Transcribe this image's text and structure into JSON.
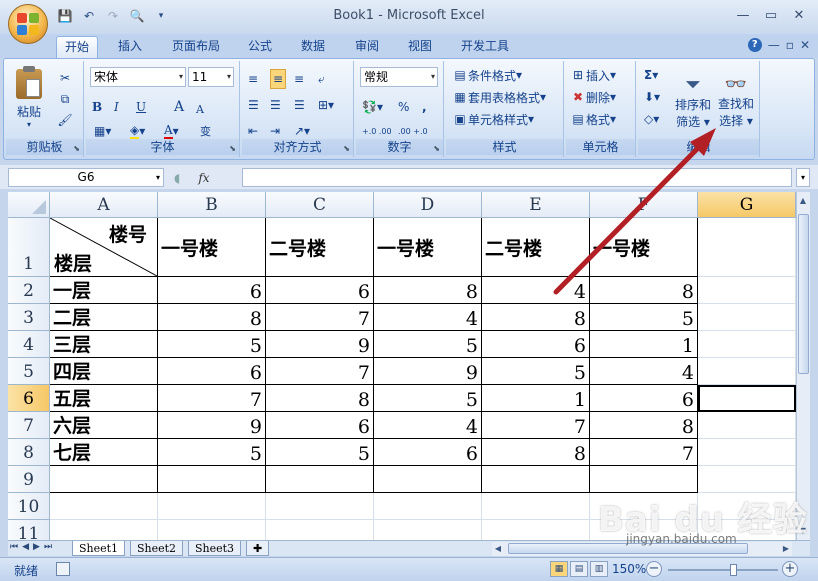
{
  "window": {
    "title": "Book1 - Microsoft Excel"
  },
  "qat": {
    "save": "💾",
    "undo": "↶",
    "redo": "↷",
    "preview": "🔍"
  },
  "tabs": [
    "开始",
    "插入",
    "页面布局",
    "公式",
    "数据",
    "审阅",
    "视图",
    "开发工具"
  ],
  "ribbon": {
    "clipboard": {
      "label": "剪贴板",
      "paste": "粘贴"
    },
    "font": {
      "label": "字体",
      "name": "宋体",
      "size": "11",
      "bold": "B",
      "italic": "I",
      "underline": "U",
      "grow": "A",
      "shrink": "A",
      "wen": "变"
    },
    "align": {
      "label": "对齐方式"
    },
    "number": {
      "label": "数字",
      "format": "常规",
      "percent": "%",
      "comma": ",",
      "inc": "+.0 .00",
      "dec": ".00 +.0"
    },
    "styles": {
      "label": "样式",
      "conditional": "条件格式",
      "table": "套用表格格式",
      "cell": "单元格样式"
    },
    "cells": {
      "label": "单元格",
      "insert": "插入",
      "delete": "删除",
      "format": "格式"
    },
    "editing": {
      "label": "编辑",
      "sigma": "Σ",
      "sort_line1": "排序和",
      "sort_line2": "筛选",
      "find_line1": "查找和",
      "find_line2": "选择"
    }
  },
  "formula_bar": {
    "namebox": "G6",
    "fx": "fx",
    "value": ""
  },
  "columns": [
    "A",
    "B",
    "C",
    "D",
    "E",
    "F",
    "G"
  ],
  "rows": [
    "1",
    "2",
    "3",
    "4",
    "5",
    "6",
    "7",
    "8",
    "9",
    "10",
    "11"
  ],
  "table": {
    "diag_top": "楼号",
    "diag_bottom": "楼层",
    "headers": [
      "一号楼",
      "二号楼",
      "一号楼",
      "二号楼",
      "一号楼"
    ],
    "body": [
      {
        "floor": "一层",
        "values": [
          "6",
          "6",
          "8",
          "4",
          "8"
        ]
      },
      {
        "floor": "二层",
        "values": [
          "8",
          "7",
          "4",
          "8",
          "5"
        ]
      },
      {
        "floor": "三层",
        "values": [
          "5",
          "9",
          "5",
          "6",
          "1"
        ]
      },
      {
        "floor": "四层",
        "values": [
          "6",
          "7",
          "9",
          "5",
          "4"
        ]
      },
      {
        "floor": "五层",
        "values": [
          "7",
          "8",
          "5",
          "1",
          "6"
        ]
      },
      {
        "floor": "六层",
        "values": [
          "9",
          "6",
          "4",
          "7",
          "8"
        ]
      },
      {
        "floor": "七层",
        "values": [
          "5",
          "5",
          "6",
          "8",
          "7"
        ]
      }
    ]
  },
  "sheet_tabs": [
    "Sheet1",
    "Sheet2",
    "Sheet3"
  ],
  "status": {
    "ready": "就绪",
    "zoom": "150%"
  },
  "watermark": {
    "brand": "Bai du 经验",
    "url": "jingyan.baidu.com"
  },
  "colors": {
    "accent": "#15428b",
    "selected_header": "#f6c867",
    "arrow": "#b21f24"
  }
}
